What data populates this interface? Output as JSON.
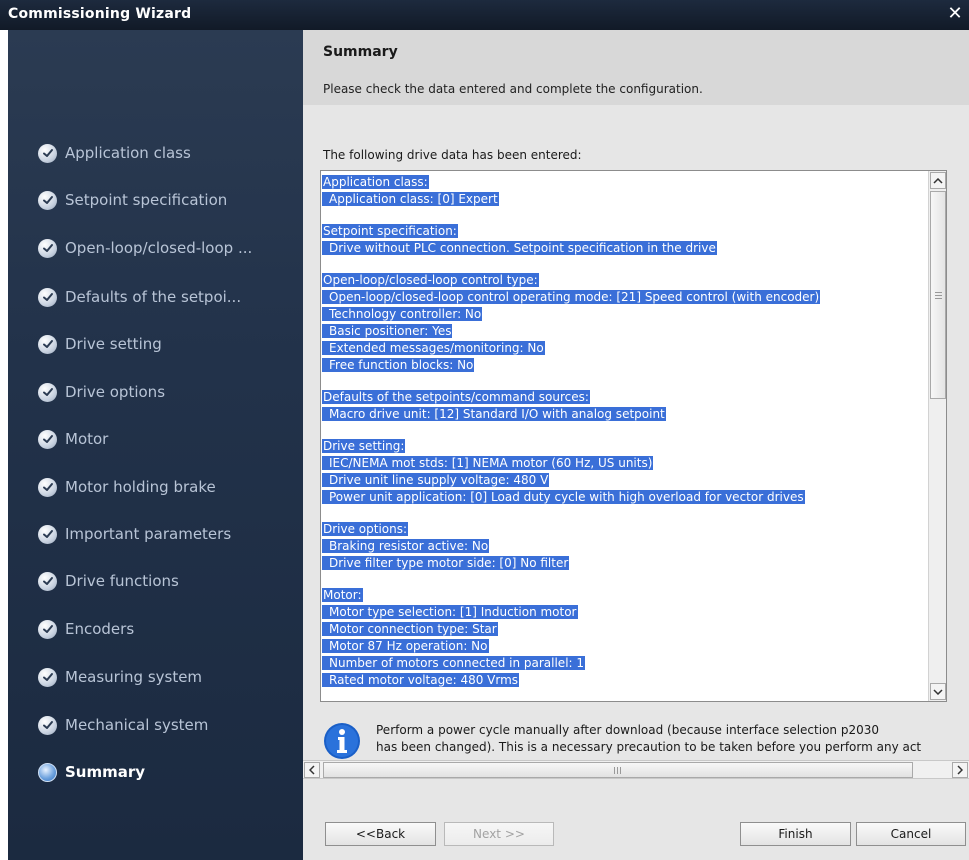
{
  "window": {
    "title": "Commissioning Wizard",
    "close_glyph": "✕"
  },
  "steps": [
    {
      "label": "Application class",
      "state": "done"
    },
    {
      "label": "Setpoint specification",
      "state": "done"
    },
    {
      "label": "Open-loop/closed-loop ...",
      "state": "done"
    },
    {
      "label": "Defaults of the setpoi...",
      "state": "done"
    },
    {
      "label": "Drive setting",
      "state": "done"
    },
    {
      "label": "Drive options",
      "state": "done"
    },
    {
      "label": "Motor",
      "state": "done"
    },
    {
      "label": "Motor holding brake",
      "state": "done"
    },
    {
      "label": "Important parameters",
      "state": "done"
    },
    {
      "label": "Drive functions",
      "state": "done"
    },
    {
      "label": "Encoders",
      "state": "done"
    },
    {
      "label": "Measuring system",
      "state": "done"
    },
    {
      "label": "Mechanical system",
      "state": "done"
    },
    {
      "label": "Summary",
      "state": "current"
    }
  ],
  "header": {
    "title": "Summary",
    "subtitle": "Please check the data entered and complete the configuration."
  },
  "intro": "The following drive data has been entered:",
  "summary": {
    "groups": [
      {
        "title": "Application class:",
        "lines": [
          "Application class: [0] Expert"
        ]
      },
      {
        "title": "Setpoint specification:",
        "lines": [
          "Drive without PLC connection. Setpoint specification in the drive"
        ]
      },
      {
        "title": "Open-loop/closed-loop control type:",
        "lines": [
          "Open-loop/closed-loop control operating mode: [21] Speed control (with encoder)",
          "Technology controller: No",
          "Basic positioner: Yes",
          "Extended messages/monitoring: No",
          "Free function blocks: No"
        ]
      },
      {
        "title": "Defaults of the setpoints/command sources:",
        "lines": [
          "Macro drive unit: [12] Standard I/O with analog setpoint"
        ]
      },
      {
        "title": "Drive setting:",
        "lines": [
          "IEC/NEMA mot stds: [1] NEMA motor (60 Hz, US units)",
          "Drive unit line supply voltage: 480 V",
          "Power unit application: [0] Load duty cycle with high overload for vector drives"
        ]
      },
      {
        "title": "Drive options:",
        "lines": [
          "Braking resistor active: No",
          "Drive filter type motor side: [0] No filter"
        ]
      },
      {
        "title": "Motor:",
        "lines": [
          "Motor type selection: [1] Induction motor",
          "Motor connection type: Star",
          "Motor 87 Hz operation: No",
          "Number of motors connected in parallel: 1",
          "Rated motor voltage: 480 Vrms"
        ]
      }
    ]
  },
  "info": {
    "icon": "info-icon",
    "line1": "Perform a power cycle manually after download (because interface selection p2030",
    "line2": "has been changed). This is a necessary precaution to be taken before you perform any act"
  },
  "buttons": {
    "back": "<<Back",
    "next": "Next >>",
    "finish": "Finish",
    "cancel": "Cancel"
  },
  "colors": {
    "selection": "#3a6fd8",
    "sidebar": "#22324a",
    "titlebar": "#111a27"
  }
}
